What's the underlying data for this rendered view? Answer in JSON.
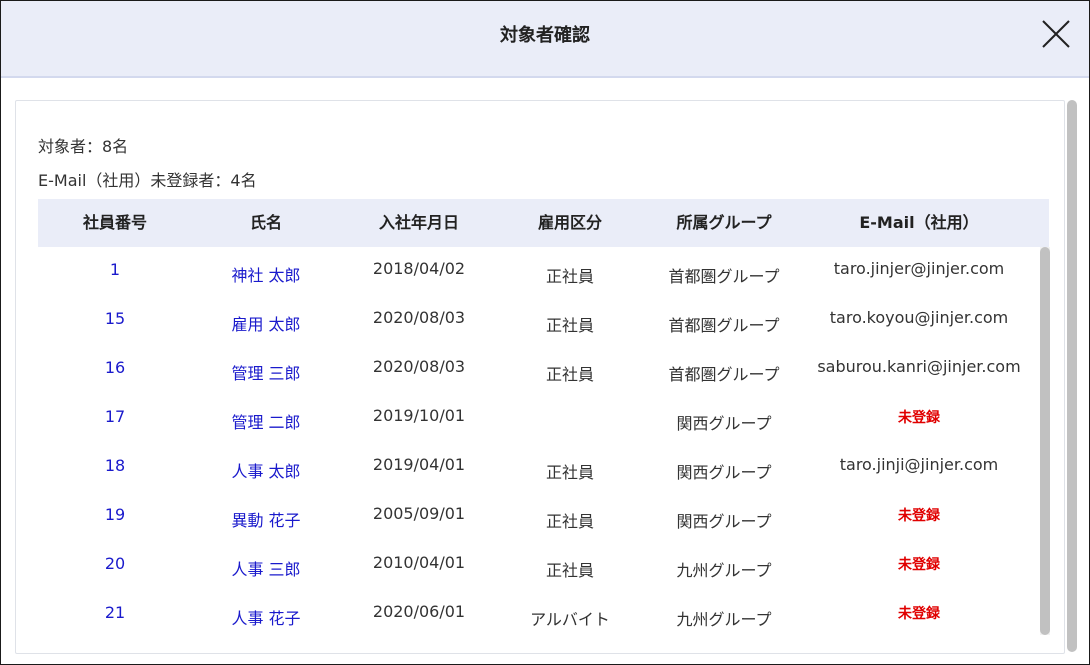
{
  "dialog": {
    "title": "対象者確認",
    "close_icon": "close-icon"
  },
  "summary": {
    "target_count": "対象者：8名",
    "unregistered_count": "E-Mail（社用）未登録者：4名"
  },
  "table": {
    "headers": {
      "id": "社員番号",
      "name": "氏名",
      "hire_date": "入社年月日",
      "employment_type": "雇用区分",
      "group": "所属グループ",
      "email": "E-Mail（社用）"
    },
    "rows": [
      {
        "id": "1",
        "name": "神社 太郎",
        "hire_date": "2018/04/02",
        "employment_type": "正社員",
        "group": "首都圏グループ",
        "email": "taro.jinjer@jinjer.com",
        "unregistered": false
      },
      {
        "id": "15",
        "name": "雇用 太郎",
        "hire_date": "2020/08/03",
        "employment_type": "正社員",
        "group": "首都圏グループ",
        "email": "taro.koyou@jinjer.com",
        "unregistered": false
      },
      {
        "id": "16",
        "name": "管理 三郎",
        "hire_date": "2020/08/03",
        "employment_type": "正社員",
        "group": "首都圏グループ",
        "email": "saburou.kanri@jinjer.com",
        "unregistered": false
      },
      {
        "id": "17",
        "name": "管理 二郎",
        "hire_date": "2019/10/01",
        "employment_type": "",
        "group": "関西グループ",
        "email": "未登録",
        "unregistered": true
      },
      {
        "id": "18",
        "name": "人事 太郎",
        "hire_date": "2019/04/01",
        "employment_type": "正社員",
        "group": "関西グループ",
        "email": "taro.jinji@jinjer.com",
        "unregistered": false
      },
      {
        "id": "19",
        "name": "異動 花子",
        "hire_date": "2005/09/01",
        "employment_type": "正社員",
        "group": "関西グループ",
        "email": "未登録",
        "unregistered": true
      },
      {
        "id": "20",
        "name": "人事 三郎",
        "hire_date": "2010/04/01",
        "employment_type": "正社員",
        "group": "九州グループ",
        "email": "未登録",
        "unregistered": true
      },
      {
        "id": "21",
        "name": "人事 花子",
        "hire_date": "2020/06/01",
        "employment_type": "アルバイト",
        "group": "九州グループ",
        "email": "未登録",
        "unregistered": true
      }
    ]
  },
  "colors": {
    "header_bg": "#eaedf8",
    "link": "#1a1acc",
    "unregistered": "#e00000"
  }
}
